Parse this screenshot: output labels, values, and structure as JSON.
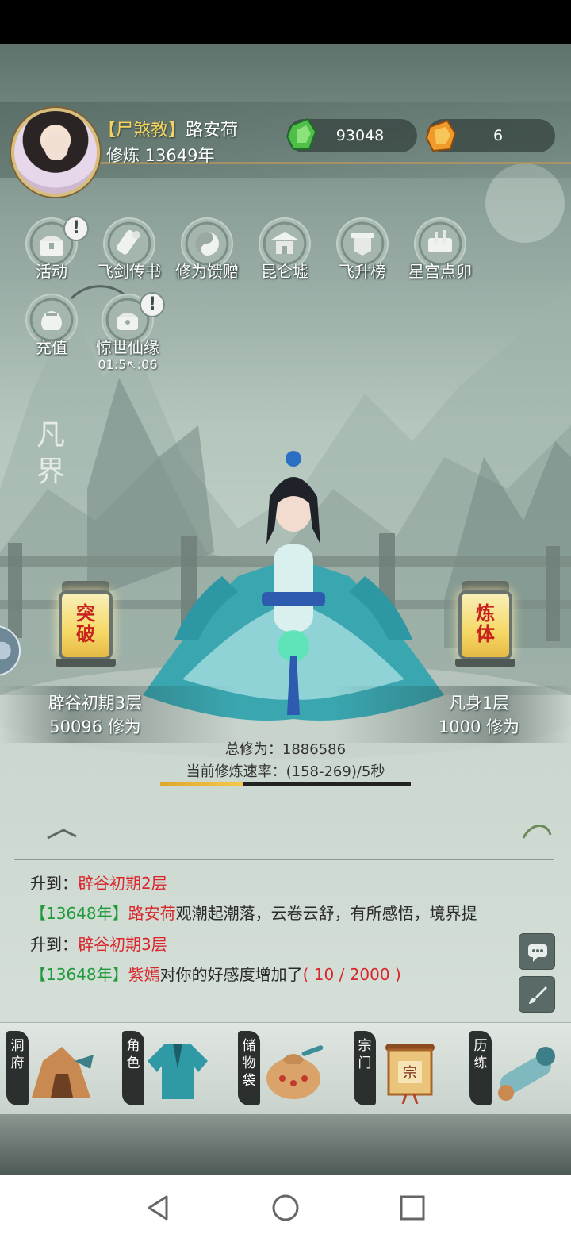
{
  "header": {
    "sect": "【尸煞教】",
    "player_name": "路安荷",
    "cultivation": "修炼 13649年",
    "jade_amount": "93048",
    "gold_amount": "6"
  },
  "menu": [
    {
      "label": "活动",
      "icon": "chest-icon",
      "alert": true
    },
    {
      "label": "飞剑传书",
      "icon": "scroll-icon",
      "alert": false
    },
    {
      "label": "修为馈赠",
      "icon": "yin-yang-icon",
      "alert": false
    },
    {
      "label": "昆仑墟",
      "icon": "palace-icon",
      "alert": false
    },
    {
      "label": "飞升榜",
      "icon": "banner-icon",
      "alert": false
    },
    {
      "label": "星宫点卯",
      "icon": "scroll-table-icon",
      "alert": false
    },
    {
      "label": "充值",
      "icon": "pouch-icon",
      "alert": false
    },
    {
      "label": "惊世仙缘",
      "icon": "treasure-icon",
      "alert": true,
      "timer": "01:5↖:06"
    }
  ],
  "realm_label": "凡界",
  "left_lantern": {
    "text": "突破",
    "stage": "辟谷初期3层",
    "xp": "50096 修为"
  },
  "right_lantern": {
    "text": "炼体",
    "stage": "凡身1层",
    "xp": "1000 修为"
  },
  "total_xp": "总修为：1886586",
  "rate": "当前修炼速率：(158-269)/5秒",
  "progress": 0.33,
  "logs": [
    {
      "prefix": "升到：",
      "highlight": "辟谷初期2层"
    },
    {
      "year": "【13648年】",
      "name": "路安荷",
      "text": "观潮起潮落，云卷云舒，有所感悟，境界提"
    },
    {
      "prefix": "升到：",
      "highlight": "辟谷初期3层"
    },
    {
      "year": "【13648年】",
      "name": "紫嫣",
      "text": "对你的好感度增加了",
      "extra": "( 10 / 2000 )"
    }
  ],
  "bottom_nav": [
    {
      "label": "洞府",
      "icon": "cave-icon"
    },
    {
      "label": "角色",
      "icon": "robe-icon"
    },
    {
      "label": "储物袋",
      "icon": "bag-icon"
    },
    {
      "label": "宗门",
      "icon": "sect-scroll-icon"
    },
    {
      "label": "历练",
      "icon": "training-scroll-icon"
    }
  ],
  "colors": {
    "sect": "#f4d35e",
    "highlight": "#d8262b",
    "year": "#1f9a3a",
    "progress": "#e0a62b"
  }
}
